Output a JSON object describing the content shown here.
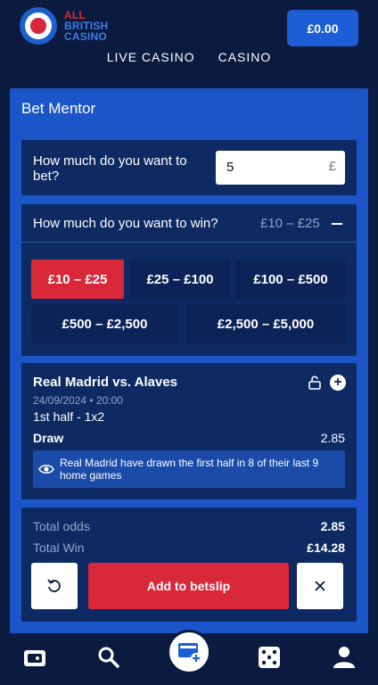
{
  "brand": {
    "line1": "ALL",
    "line2": "BRITISH",
    "line3": "CASINO",
    "logo_icon": "roundel-logo"
  },
  "header": {
    "balance": "£0.00"
  },
  "top_nav": [
    "LIVE CASINO",
    "CASINO"
  ],
  "panel": {
    "title": "Bet Mentor",
    "bet_question": "How much do you want to bet?",
    "bet_value": "5",
    "bet_currency": "£",
    "win_question": "How much do you want to win?",
    "win_selected_range": "£10 – £25",
    "win_options": [
      "£10 – £25",
      "£25 – £100",
      "£100 – £500",
      "£500 – £2,500",
      "£2,500 – £5,000"
    ],
    "selection": {
      "match": "Real Madrid vs. Alaves",
      "date": "24/09/2024 • 20:00",
      "market": "1st half - 1x2",
      "outcome": "Draw",
      "odds": "2.85",
      "insight": "Real Madrid have drawn the first half in 8 of their last 9 home games"
    },
    "totals": {
      "odds_label": "Total odds",
      "odds_value": "2.85",
      "win_label": "Total Win",
      "win_value": "£14.28"
    },
    "add_button": "Add to betslip"
  },
  "colors": {
    "accent_red": "#d8283a",
    "brand_blue": "#1d5ed6",
    "panel_blue": "#1a56c8",
    "card_navy": "#0e2a63"
  },
  "bottom_nav": [
    "wallet-icon",
    "search-icon",
    "betslip-icon",
    "dice-icon",
    "user-icon"
  ]
}
